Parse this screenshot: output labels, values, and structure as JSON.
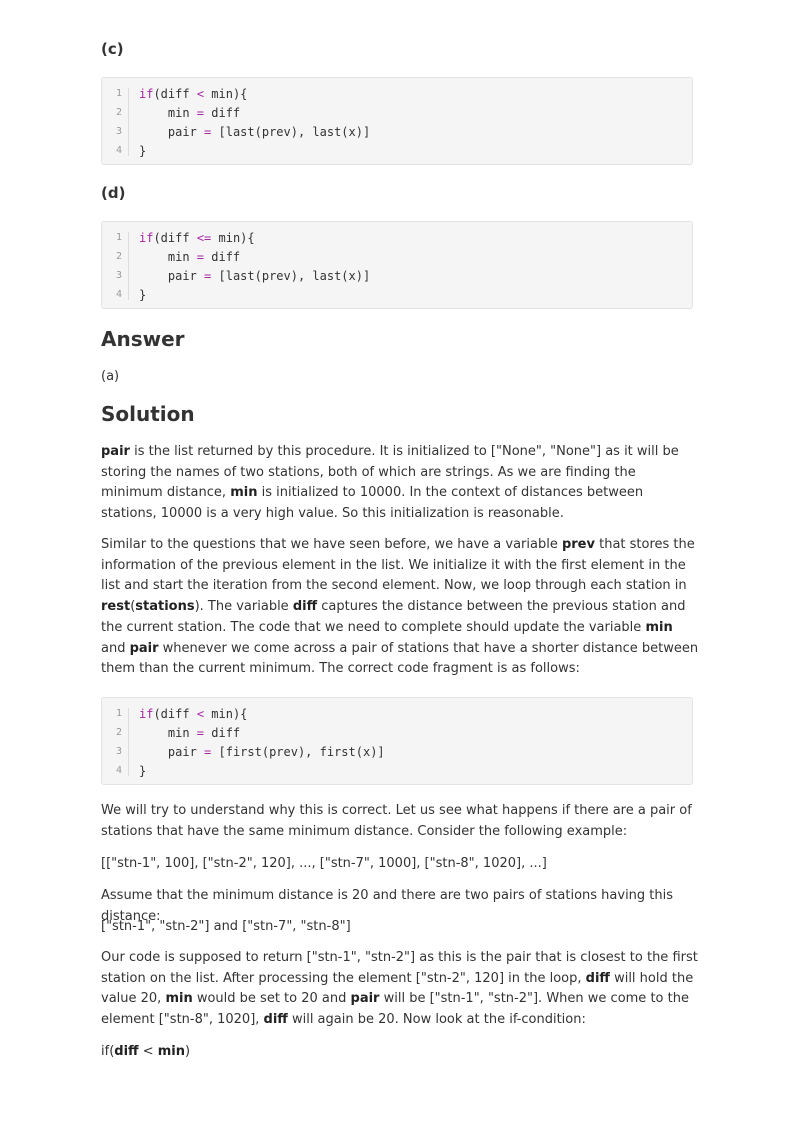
{
  "options": [
    {
      "label": "(c)",
      "lines": [
        {
          "num": "1",
          "parts": [
            {
              "t": "if",
              "c": "kw"
            },
            {
              "t": "(diff ",
              "c": ""
            },
            {
              "t": "<",
              "c": "op"
            },
            {
              "t": " min){",
              "c": ""
            }
          ]
        },
        {
          "num": "2",
          "parts": [
            {
              "t": "    min ",
              "c": ""
            },
            {
              "t": "=",
              "c": "op"
            },
            {
              "t": " diff",
              "c": ""
            }
          ]
        },
        {
          "num": "3",
          "parts": [
            {
              "t": "    pair ",
              "c": ""
            },
            {
              "t": "=",
              "c": "op"
            },
            {
              "t": " [last(prev), last(x)]",
              "c": ""
            }
          ]
        },
        {
          "num": "4",
          "parts": [
            {
              "t": "}",
              "c": ""
            }
          ]
        }
      ]
    },
    {
      "label": "(d)",
      "lines": [
        {
          "num": "1",
          "parts": [
            {
              "t": "if",
              "c": "kw"
            },
            {
              "t": "(diff ",
              "c": ""
            },
            {
              "t": "<=",
              "c": "op"
            },
            {
              "t": " min){",
              "c": ""
            }
          ]
        },
        {
          "num": "2",
          "parts": [
            {
              "t": "    min ",
              "c": ""
            },
            {
              "t": "=",
              "c": "op"
            },
            {
              "t": " diff",
              "c": ""
            }
          ]
        },
        {
          "num": "3",
          "parts": [
            {
              "t": "    pair ",
              "c": ""
            },
            {
              "t": "=",
              "c": "op"
            },
            {
              "t": " [last(prev), last(x)]",
              "c": ""
            }
          ]
        },
        {
          "num": "4",
          "parts": [
            {
              "t": "}",
              "c": ""
            }
          ]
        }
      ]
    }
  ],
  "answer": {
    "heading": "Answer",
    "value": "(a)"
  },
  "solution": {
    "heading": "Solution",
    "para1": [
      {
        "t": "pair",
        "b": true
      },
      {
        "t": " is the list returned by this procedure. It is initialized to [\"None\", \"None\"] as it will be storing the names of two stations, both of which are strings. As we are finding the minimum distance, ",
        "b": false
      },
      {
        "t": "min",
        "b": true
      },
      {
        "t": " is initialized to 10000. In the context of distances between stations, 10000 is a very high value. So this initialization is reasonable.",
        "b": false
      }
    ],
    "para2": [
      {
        "t": "Similar to the questions that we have seen before, we have a variable ",
        "b": false
      },
      {
        "t": "prev",
        "b": true
      },
      {
        "t": " that stores the information of the previous element in the list. We initialize it with the first element in the list and start the iteration from the second element. Now, we loop through each station in ",
        "b": false
      },
      {
        "t": "rest",
        "b": true
      },
      {
        "t": "(",
        "b": false
      },
      {
        "t": "stations",
        "b": true
      },
      {
        "t": "). The variable ",
        "b": false
      },
      {
        "t": "diff",
        "b": true
      },
      {
        "t": " captures the distance between the previous station and the current station. The code that we need to complete should update the variable ",
        "b": false
      },
      {
        "t": "min",
        "b": true
      },
      {
        "t": " and ",
        "b": false
      },
      {
        "t": "pair",
        "b": true
      },
      {
        "t": " whenever we come across a pair of stations that have a shorter distance between them than the current minimum. The correct code fragment is as follows:",
        "b": false
      }
    ],
    "code": [
      {
        "num": "1",
        "parts": [
          {
            "t": "if",
            "c": "kw"
          },
          {
            "t": "(diff ",
            "c": ""
          },
          {
            "t": "<",
            "c": "op"
          },
          {
            "t": " min){",
            "c": ""
          }
        ]
      },
      {
        "num": "2",
        "parts": [
          {
            "t": "    min ",
            "c": ""
          },
          {
            "t": "=",
            "c": "op"
          },
          {
            "t": " diff",
            "c": ""
          }
        ]
      },
      {
        "num": "3",
        "parts": [
          {
            "t": "    pair ",
            "c": ""
          },
          {
            "t": "=",
            "c": "op"
          },
          {
            "t": " [first(prev), first(x)]",
            "c": ""
          }
        ]
      },
      {
        "num": "4",
        "parts": [
          {
            "t": "}",
            "c": ""
          }
        ]
      }
    ],
    "para3": [
      {
        "t": "We will try to understand why this is correct. Let us see what happens if there are a pair of stations that have the same minimum distance. Consider the following example:",
        "b": false
      }
    ],
    "para4": [
      {
        "t": "[[\"stn-1\", 100], [\"stn-2\", 120], ..., [\"stn-7\", 1000], [\"stn-8\", 1020], ...]",
        "b": false
      }
    ],
    "para5": [
      {
        "t": "Assume that the minimum distance is 20 and there are two pairs of stations having this distance:",
        "b": false
      }
    ],
    "para6": [
      {
        "t": "[\"stn-1\", \"stn-2\"] and [\"stn-7\", \"stn-8\"]",
        "b": false
      }
    ],
    "para7": [
      {
        "t": "Our code is supposed to return [\"stn-1\", \"stn-2\"] as this is the pair that is closest to the first station on the list. After processing the element [\"stn-2\", 120] in the loop, ",
        "b": false
      },
      {
        "t": "diff",
        "b": true
      },
      {
        "t": " will hold the value 20, ",
        "b": false
      },
      {
        "t": "min",
        "b": true
      },
      {
        "t": " would be set to 20 and ",
        "b": false
      },
      {
        "t": "pair",
        "b": true
      },
      {
        "t": " will be [\"stn-1\", \"stn-2\"]. When we come to the element [\"stn-8\", 1020], ",
        "b": false
      },
      {
        "t": "diff",
        "b": true
      },
      {
        "t": " will again be 20. Now look at the if-condition:",
        "b": false
      }
    ],
    "para8": [
      {
        "t": "if(",
        "b": false
      },
      {
        "t": "diff",
        "b": true
      },
      {
        "t": " < ",
        "b": false
      },
      {
        "t": "min",
        "b": true
      },
      {
        "t": ")",
        "b": false
      }
    ]
  }
}
